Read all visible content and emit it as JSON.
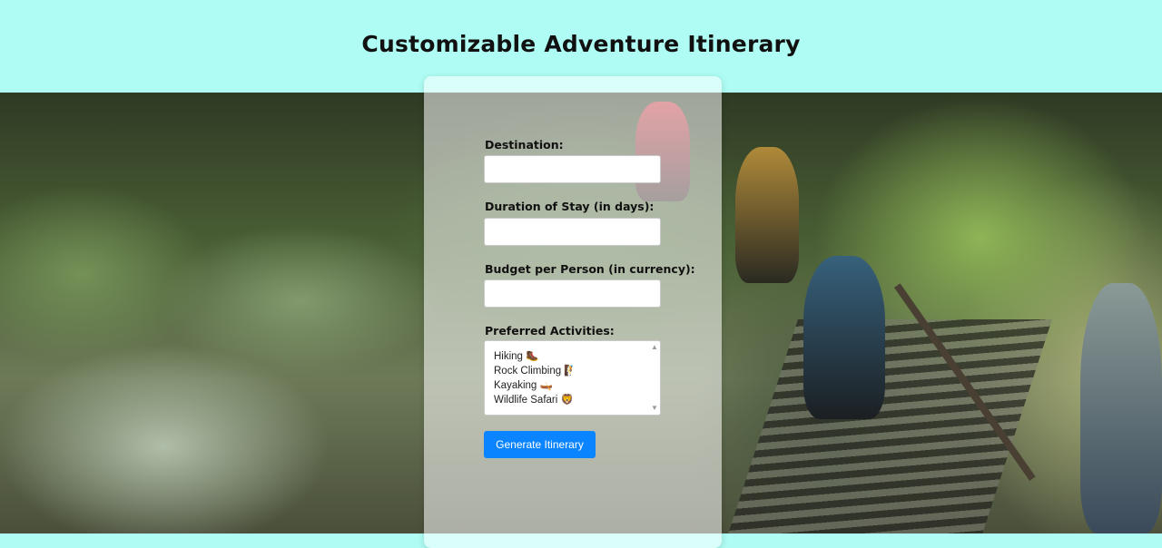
{
  "page": {
    "title": "Customizable Adventure Itinerary"
  },
  "form": {
    "destination": {
      "label": "Destination:",
      "value": ""
    },
    "duration": {
      "label": "Duration of Stay (in days):",
      "value": ""
    },
    "budget": {
      "label": "Budget per Person (in currency):",
      "value": ""
    },
    "activities": {
      "label": "Preferred Activities:",
      "options": [
        "Hiking 🥾",
        "Rock Climbing 🧗",
        "Kayaking 🛶",
        "Wildlife Safari 🦁"
      ]
    },
    "submit_label": "Generate Itinerary"
  },
  "colors": {
    "header_bg": "#aefcf3",
    "button_bg": "#0a84ff"
  },
  "background": {
    "icon": "forest-hiking-photo"
  }
}
